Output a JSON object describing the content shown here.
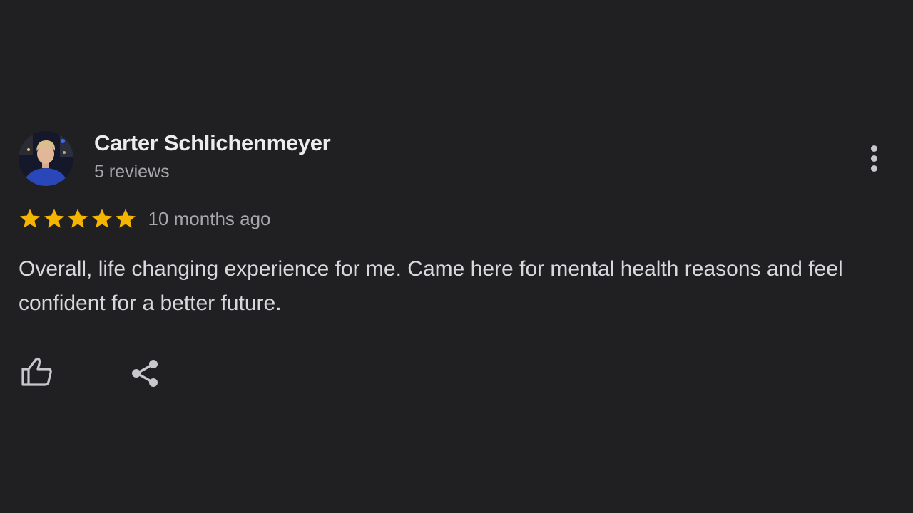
{
  "review": {
    "author_name": "Carter Schlichenmeyer",
    "review_count": "5 reviews",
    "rating": 5,
    "rating_max": 5,
    "time_ago": "10 months ago",
    "text": "Overall, life changing experience for me. Came here for mental health reasons and feel confident for a better future."
  },
  "icons": {
    "avatar": "user-photo",
    "menu": "more-vert-icon",
    "star": "star-icon",
    "like": "thumb-up-icon",
    "share": "share-icon"
  },
  "colors": {
    "background": "#201f22",
    "star": "#f5b400",
    "name": "#ececec",
    "meta": "#a8a8ac",
    "body": "#d8d8dc"
  }
}
